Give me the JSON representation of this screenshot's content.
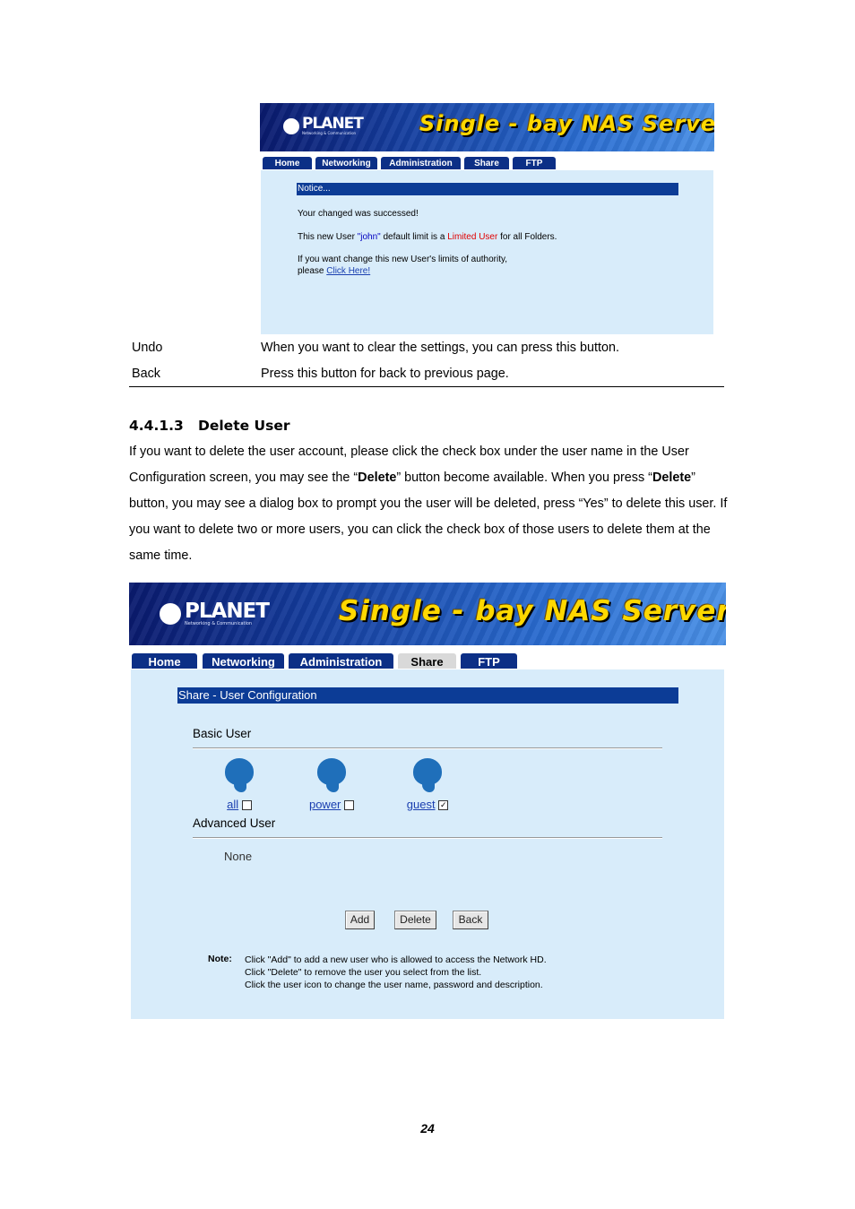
{
  "fig1": {
    "logo": "PLANET",
    "logo_sub": "Networking & Communication",
    "banner_title": "Single - bay NAS Server",
    "tabs": [
      "Home",
      "Networking",
      "Administration",
      "Share",
      "FTP"
    ],
    "notice_title": "Notice...",
    "line1": "Your changed was successed!",
    "line2_pre": "This new User ",
    "line2_user": "\"john\"",
    "line2_mid": " default limit is a ",
    "line2_limit": "Limited User",
    "line2_post": " for all Folders.",
    "line3": "If you want change this new User's limits of authority,",
    "line4_pre": "please ",
    "line4_link": "Click Here!"
  },
  "table_rows": [
    {
      "term": "Undo",
      "desc": "When you want to clear the settings, you can press this button."
    },
    {
      "term": "Back",
      "desc": "Press this button for back to previous page."
    }
  ],
  "section": {
    "heading": "4.4.1.3   Delete User",
    "p_a": "If you want to delete the user account, please click the check box under the user name in the User",
    "p_b1": "Configuration screen, you may see the “",
    "p_b_bold1": "Delete",
    "p_b2": "” button become available. When you press “",
    "p_b_bold2": "Delete",
    "p_b3": "”",
    "p_c": "button, you may see a dialog box to prompt you the user will be deleted, press “Yes” to delete this user. If",
    "p_d": "you want to delete two or more users, you can click the check box of those users to delete them at the",
    "p_e": "same time."
  },
  "fig2": {
    "logo": "PLANET",
    "logo_sub": "Networking & Communication",
    "banner_title": "Single - bay NAS Server",
    "tabs": [
      "Home",
      "Networking",
      "Administration",
      "Share",
      "FTP"
    ],
    "active_tab": "Share",
    "section_bar": "Share - User Configuration",
    "basic_user": "Basic User",
    "users": [
      {
        "name": "all",
        "checked": false
      },
      {
        "name": "power",
        "checked": false
      },
      {
        "name": "guest",
        "checked": true
      }
    ],
    "advanced_user": "Advanced User",
    "none": "None",
    "buttons": {
      "add": "Add",
      "delete": "Delete",
      "back": "Back"
    },
    "note_label": "Note:",
    "notes": [
      "Click \"Add\" to add a new user who is allowed to access the Network HD.",
      "Click \"Delete\" to remove the user you select from the list.",
      "Click the user icon to change the user name, password and description."
    ]
  },
  "page_number": "24"
}
